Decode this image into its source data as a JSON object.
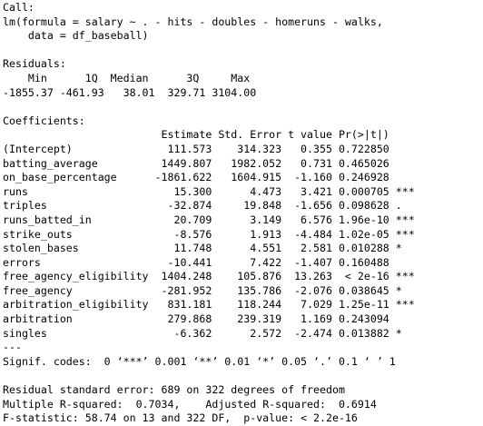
{
  "call": {
    "header": "Call:",
    "line1": "lm(formula = salary ~ . - hits - doubles - homeruns - walks,",
    "line2": "    data = df_baseball)"
  },
  "residuals": {
    "header": "Residuals:",
    "labels": "    Min      1Q  Median      3Q     Max ",
    "values": "-1855.37 -461.93   38.01  329.71 3104.00 "
  },
  "coefficients": {
    "header": "Coefficients:",
    "column_header": "                         Estimate Std. Error t value Pr(>|t|)    ",
    "rows": [
      "(Intercept)               111.573    314.323   0.355 0.722850    ",
      "batting_average          1449.807   1982.052   0.731 0.465026    ",
      "on_base_percentage      -1861.622   1604.915  -1.160 0.246928    ",
      "runs                       15.300      4.473   3.421 0.000705 ***",
      "triples                   -32.874     19.848  -1.656 0.098628 .  ",
      "runs_batted_in             20.709      3.149   6.576 1.96e-10 ***",
      "strike_outs                -8.576      1.913  -4.484 1.02e-05 ***",
      "stolen_bases               11.748      4.551   2.581 0.010288 *  ",
      "errors                    -10.441      7.422  -1.407 0.160488    ",
      "free_agency_eligibility  1404.248    105.876  13.263  < 2e-16 ***",
      "free_agency              -281.952    135.786  -2.076 0.038645 *  ",
      "arbitration_eligibility   831.181    118.244   7.029 1.25e-11 ***",
      "arbitration               279.868    239.319   1.169 0.243094    ",
      "singles                    -6.362      2.572  -2.474 0.013882 *  "
    ],
    "separator": "---",
    "signif_codes": "Signif. codes:  0 ‘***’ 0.001 ‘**’ 0.01 ‘*’ 0.05 ‘.’ 0.1 ‘ ’ 1"
  },
  "summary": {
    "residual_se": "Residual standard error: 689 on 322 degrees of freedom",
    "r_squared": "Multiple R-squared:  0.7034,\tAdjusted R-squared:  0.6914 ",
    "f_statistic": "F-statistic: 58.74 on 13 and 322 DF,  p-value: < 2.2e-16"
  }
}
